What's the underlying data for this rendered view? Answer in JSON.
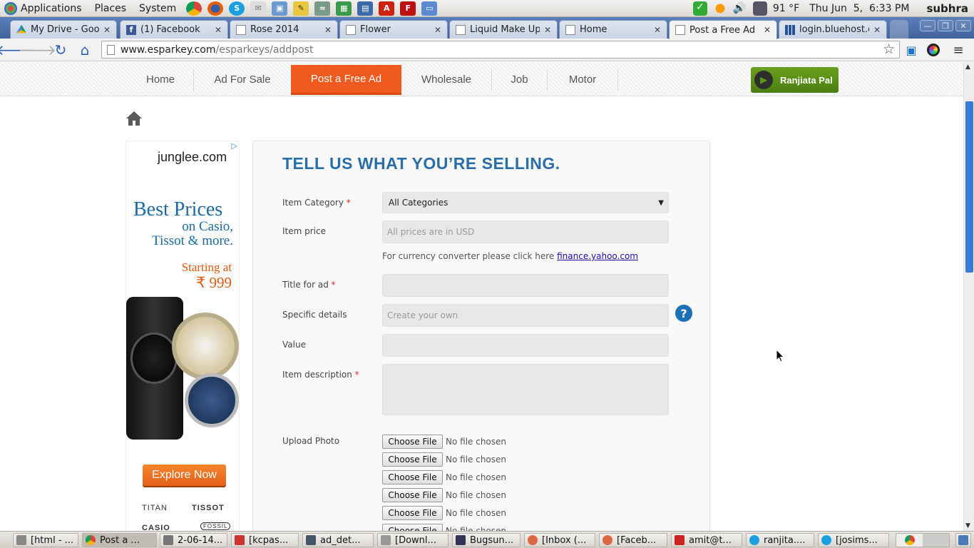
{
  "top_panel": {
    "menus": [
      "Applications",
      "Places",
      "System"
    ],
    "temperature": "91 °F",
    "datetime": "Thu Jun  5,  6:33 PM",
    "username": "subhra"
  },
  "tabs": [
    {
      "title": "My Drive - Google",
      "icon": "google-drive-icon"
    },
    {
      "title": "(1) Facebook",
      "icon": "facebook-icon"
    },
    {
      "title": "Rose 2014",
      "icon": "page-icon"
    },
    {
      "title": "Flower",
      "icon": "page-icon"
    },
    {
      "title": "Liquid Make Up",
      "icon": "page-icon"
    },
    {
      "title": "Home",
      "icon": "page-icon"
    },
    {
      "title": "Post a Free Ad",
      "icon": "page-icon",
      "active": true
    },
    {
      "title": "login.bluehost.cc",
      "icon": "grid-icon"
    }
  ],
  "address_bar": {
    "host": "www.esparkey.com",
    "path": "/esparkeys/addpost"
  },
  "site_nav": {
    "items": [
      "Home",
      "Ad For Sale",
      "Post a Free Ad",
      "Wholesale",
      "Job",
      "Motor"
    ],
    "active": "Post a Free Ad",
    "user_button": "Ranjiata Pal"
  },
  "ad": {
    "brand": "junglee.com",
    "headline": "Best Prices",
    "subhead_1": "on Casio,",
    "subhead_2": "Tissot & more.",
    "starting_at": "Starting at",
    "price": "₹ 999",
    "cta": "Explore Now",
    "logos": [
      "TITAN",
      "TISSOT",
      "CASIO",
      "FOSSIL"
    ]
  },
  "form": {
    "title": "TELL US WHAT YOU’RE SELLING.",
    "labels": {
      "category": "Item Category",
      "price": "Item price",
      "title": "Title for ad",
      "details": "Specific details",
      "value": "Value",
      "description": "Item description",
      "upload": "Upload Photo"
    },
    "required_mark": "*",
    "category_value": "All Categories",
    "price_placeholder": "All prices are in USD",
    "details_placeholder": "Create your own",
    "currency_hint": "For currency converter please click here",
    "currency_link": "finance.yahoo.com",
    "help_symbol": "?",
    "choose_file_label": "Choose File",
    "no_file_label": "No file chosen"
  },
  "taskbar": [
    {
      "label": "[html - ...",
      "color": "#888"
    },
    {
      "label": "Post a ...",
      "color": "#d33",
      "active": true
    },
    {
      "label": "2-06-14...",
      "color": "#777"
    },
    {
      "label": "[kcpas...",
      "color": "#c33"
    },
    {
      "label": "ad_det...",
      "color": "#456"
    },
    {
      "label": "[Downl...",
      "color": "#999"
    },
    {
      "label": "Bugsun...",
      "color": "#335"
    },
    {
      "label": "[Inbox (...",
      "color": "#d64"
    },
    {
      "label": "[Faceb...",
      "color": "#d64"
    },
    {
      "label": "amit@t...",
      "color": "#c22"
    },
    {
      "label": "ranjita....",
      "color": "#1aa0e0"
    },
    {
      "label": "[josims...",
      "color": "#1aa0e0"
    }
  ],
  "colors": {
    "accent_orange": "#f05a1e",
    "title_blue": "#2a6ea8",
    "user_green": "#5b9a18"
  }
}
